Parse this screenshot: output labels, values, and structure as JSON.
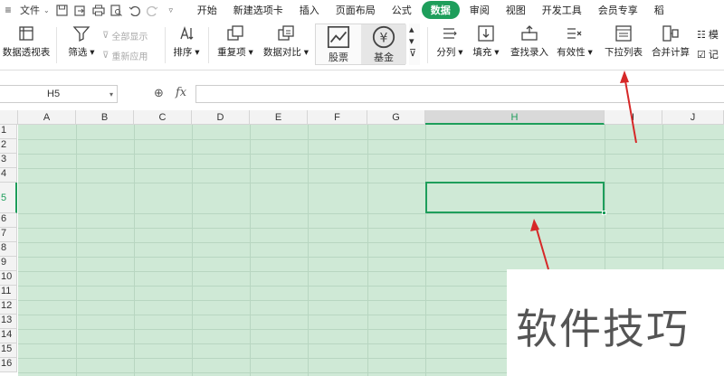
{
  "menubar": {
    "file_label": "文件",
    "tabs": [
      "开始",
      "新建选项卡",
      "插入",
      "页面布局",
      "公式",
      "数据",
      "审阅",
      "视图",
      "开发工具",
      "会员专享",
      "稻"
    ],
    "active_tab": "数据"
  },
  "ribbon": {
    "pivot_label": "数据透视表",
    "filter_label": "筛选",
    "show_all_label": "全部显示",
    "reapply_label": "重新应用",
    "sort_label": "排序",
    "duplicates_label": "重复项",
    "compare_label": "数据对比",
    "stock_label": "股票",
    "fund_label": "基金",
    "split_label": "分列",
    "fill_label": "填充",
    "lookup_label": "查找录入",
    "validity_label": "有效性",
    "dropdown_label": "下拉列表",
    "merge_calc_label": "合并计算",
    "mock_label": "模",
    "record_label": "记"
  },
  "formula_bar": {
    "cell_ref": "H5",
    "fx": "fx",
    "formula": ""
  },
  "grid": {
    "columns": [
      "A",
      "B",
      "C",
      "D",
      "E",
      "F",
      "G",
      "H",
      "I",
      "J"
    ],
    "rows": [
      "1",
      "2",
      "3",
      "4",
      "5",
      "6",
      "7",
      "8",
      "9",
      "10",
      "11",
      "12",
      "13",
      "14",
      "15",
      "16"
    ],
    "selected_column": "H",
    "selected_row": "5"
  },
  "watermark": {
    "text": "软件技巧"
  },
  "colors": {
    "accent": "#1e9e5b",
    "cell_fill": "#cfe9d6",
    "arrow": "#d62828"
  }
}
